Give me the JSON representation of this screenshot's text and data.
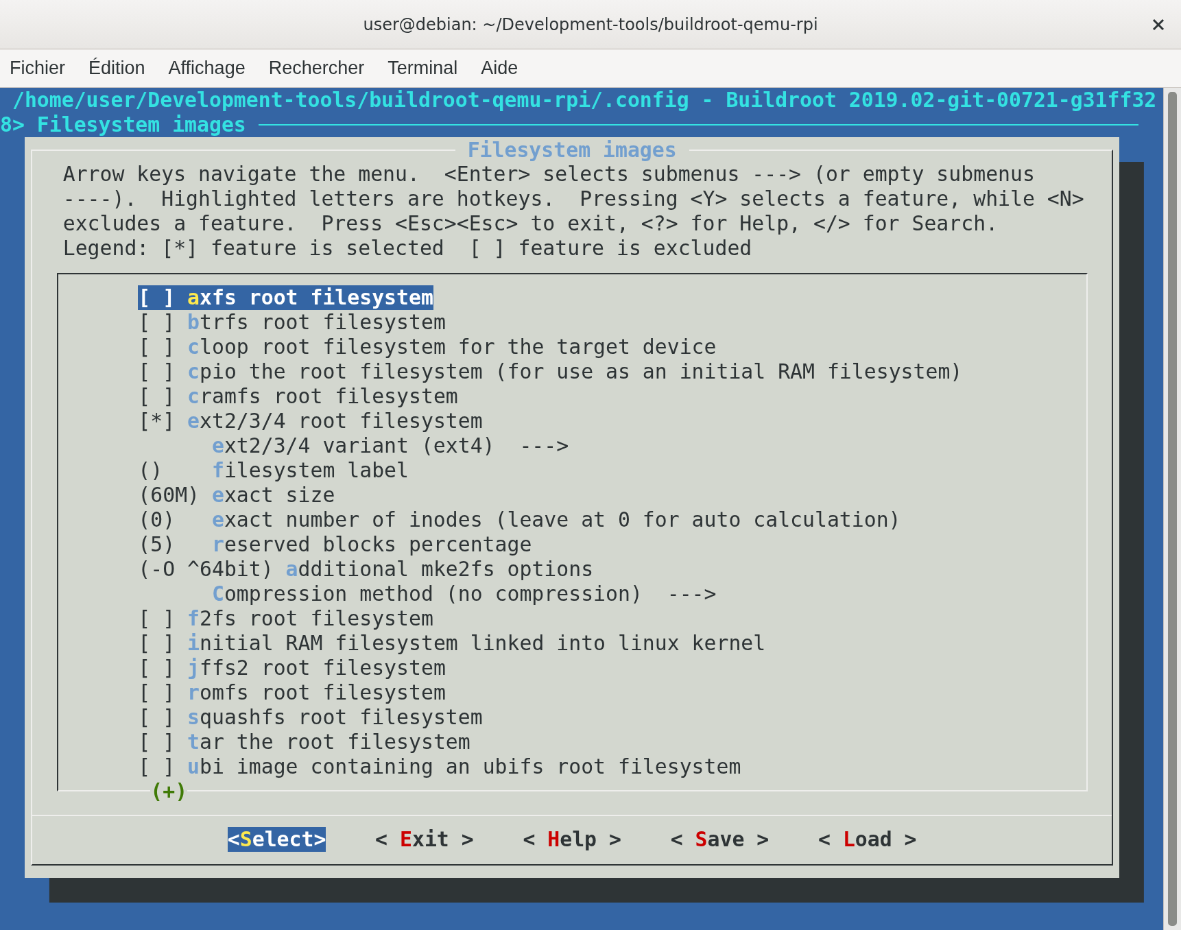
{
  "window": {
    "title": "user@debian: ~/Development-tools/buildroot-qemu-rpi"
  },
  "menu": [
    "Fichier",
    "Édition",
    "Affichage",
    "Rechercher",
    "Terminal",
    "Aide"
  ],
  "terminal": {
    "backtitle": "/home/user/Development-tools/buildroot-qemu-rpi/.config - Buildroot 2019.02-git-00721-g31ff32",
    "breadcrumb": "8> Filesystem images",
    "dialog": {
      "title": "Filesystem images",
      "help": [
        "Arrow keys navigate the menu.  <Enter> selects submenus ---> (or empty submenus",
        "----).  Highlighted letters are hotkeys.  Pressing <Y> selects a feature, while <N>",
        "excludes a feature.  Press <Esc><Esc> to exit, <?> for Help, </> for Search.",
        "Legend: [*] feature is selected  [ ] feature is excluded"
      ],
      "items": [
        {
          "kind": "bool",
          "value": "[ ]",
          "hotkey": "a",
          "rest": "xfs root filesystem",
          "selected": true
        },
        {
          "kind": "bool",
          "value": "[ ]",
          "hotkey": "b",
          "rest": "trfs root filesystem",
          "selected": false
        },
        {
          "kind": "bool",
          "value": "[ ]",
          "hotkey": "c",
          "rest": "loop root filesystem for the target device",
          "selected": false
        },
        {
          "kind": "bool",
          "value": "[ ]",
          "hotkey": "c",
          "rest": "pio the root filesystem (for use as an initial RAM filesystem)",
          "selected": false
        },
        {
          "kind": "bool",
          "value": "[ ]",
          "hotkey": "c",
          "rest": "ramfs root filesystem",
          "selected": false
        },
        {
          "kind": "bool",
          "value": "[*]",
          "hotkey": "e",
          "rest": "xt2/3/4 root filesystem",
          "selected": false
        },
        {
          "kind": "menu",
          "hotkey": "e",
          "rest": "xt2/3/4 variant (ext4)  --->",
          "selected": false
        },
        {
          "kind": "value",
          "value": "()",
          "hotkey": "f",
          "rest": "ilesystem label",
          "selected": false
        },
        {
          "kind": "value",
          "value": "(60M)",
          "hotkey": "e",
          "rest": "xact size",
          "selected": false
        },
        {
          "kind": "value",
          "value": "(0)",
          "hotkey": "e",
          "rest": "xact number of inodes (leave at 0 for auto calculation)",
          "selected": false
        },
        {
          "kind": "value",
          "value": "(5)",
          "hotkey": "r",
          "rest": "eserved blocks percentage",
          "selected": false
        },
        {
          "kind": "value",
          "value": "(-O ^64bit)",
          "hotkey": "a",
          "rest": "dditional mke2fs options",
          "selected": false
        },
        {
          "kind": "menu",
          "hotkey": "C",
          "rest": "ompression method (no compression)  --->",
          "selected": false
        },
        {
          "kind": "bool",
          "value": "[ ]",
          "hotkey": "f",
          "rest": "2fs root filesystem",
          "selected": false
        },
        {
          "kind": "bool",
          "value": "[ ]",
          "hotkey": "i",
          "rest": "nitial RAM filesystem linked into linux kernel",
          "selected": false
        },
        {
          "kind": "bool",
          "value": "[ ]",
          "hotkey": "j",
          "rest": "ffs2 root filesystem",
          "selected": false
        },
        {
          "kind": "bool",
          "value": "[ ]",
          "hotkey": "r",
          "rest": "omfs root filesystem",
          "selected": false
        },
        {
          "kind": "bool",
          "value": "[ ]",
          "hotkey": "s",
          "rest": "quashfs root filesystem",
          "selected": false
        },
        {
          "kind": "bool",
          "value": "[ ]",
          "hotkey": "t",
          "rest": "ar the root filesystem",
          "selected": false
        },
        {
          "kind": "bool",
          "value": "[ ]",
          "hotkey": "u",
          "rest": "bi image containing an ubifs root filesystem",
          "selected": false
        }
      ],
      "more_indicator": "(+)",
      "buttons": [
        {
          "before": "<",
          "hotkey": "S",
          "after": "elect>",
          "selected": true
        },
        {
          "before": "< ",
          "hotkey": "E",
          "after": "xit >",
          "selected": false
        },
        {
          "before": "< ",
          "hotkey": "H",
          "after": "elp >",
          "selected": false
        },
        {
          "before": "< ",
          "hotkey": "S",
          "after": "ave >",
          "selected": false
        },
        {
          "before": "< ",
          "hotkey": "L",
          "after": "oad >",
          "selected": false
        }
      ]
    }
  }
}
